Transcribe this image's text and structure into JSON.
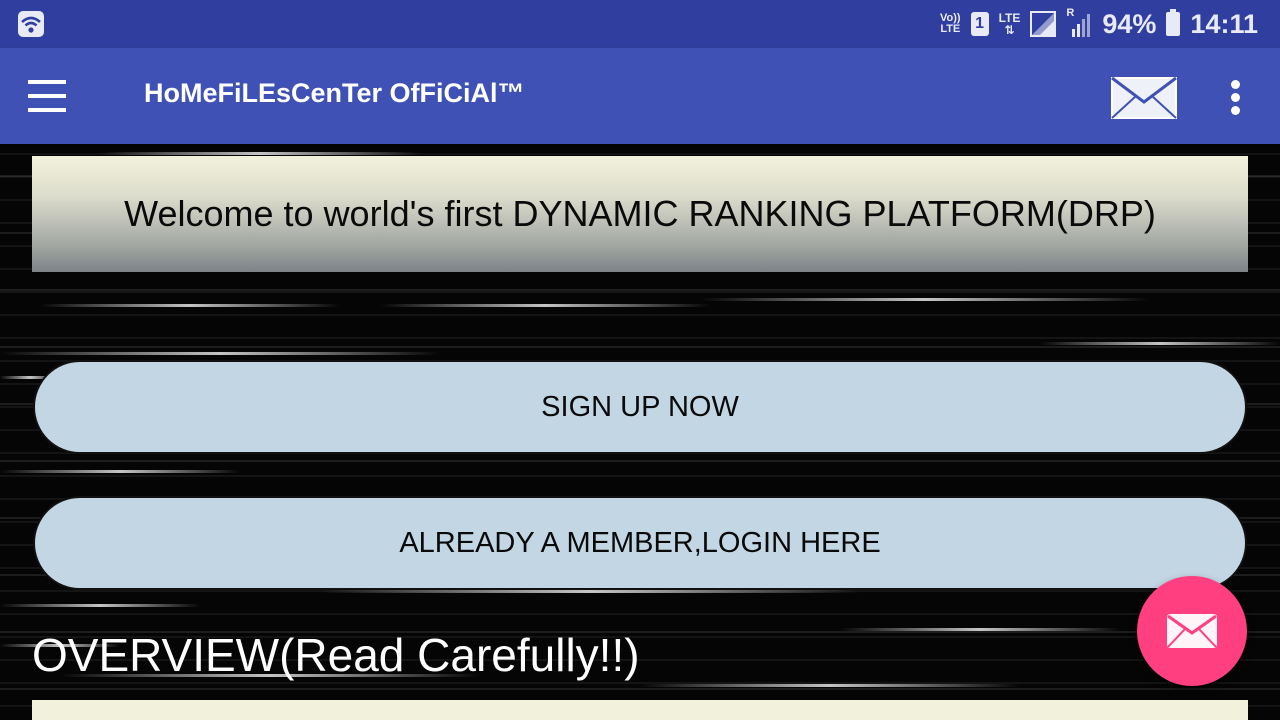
{
  "status_bar": {
    "volte_top": "Vo))",
    "volte_bottom": "LTE",
    "sim_slot": "1",
    "lte_label": "LTE",
    "lte_arrows": "⇅",
    "roaming": "R",
    "battery_percent": "94%",
    "time": "14:11"
  },
  "app_bar": {
    "title": "HoMeFiLEsCenTer OfFiCiAl™",
    "menu_icon": "hamburger-menu-icon",
    "mail_icon": "envelope-icon",
    "more_icon": "more-vertical-icon"
  },
  "content": {
    "welcome_text": "Welcome to world's first DYNAMIC RANKING PLATFORM(DRP)",
    "signup_label": "SIGN UP NOW",
    "login_label": "ALREADY A MEMBER,LOGIN HERE",
    "overview_heading": "OVERVIEW(Read Carefully!!)"
  },
  "fab": {
    "icon": "envelope-icon",
    "color": "#ff3f7f"
  },
  "colors": {
    "status_bar": "#303f9f",
    "app_bar": "#3f51b5",
    "button_fill": "#c3d6e4"
  }
}
